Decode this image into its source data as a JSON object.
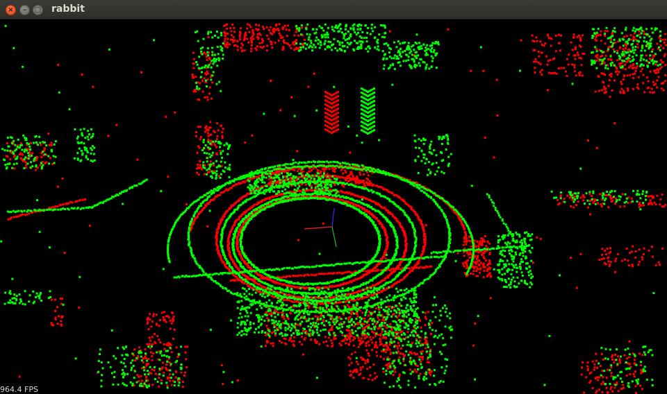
{
  "window": {
    "title": "rabbit",
    "close_glyph": "×",
    "minimize_glyph": "–",
    "maximize_glyph": "□"
  },
  "viewport": {
    "fps_text": "964.4 FPS",
    "point_cloud_colors": [
      "#ff0000",
      "#00ff00"
    ],
    "axis_colors": {
      "x": "#ff2020",
      "y": "#20c020",
      "z": "#3030ff"
    }
  }
}
